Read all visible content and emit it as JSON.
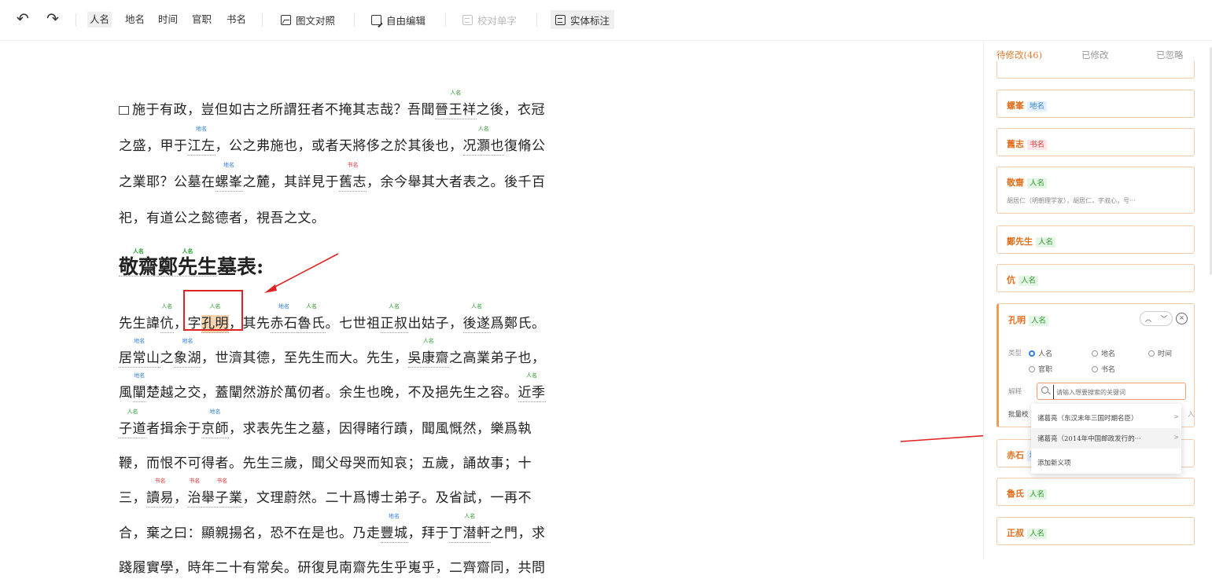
{
  "toolbar": {
    "undo_icon": "undo-icon",
    "redo_icon": "redo-icon",
    "filters": [
      "人名",
      "地名",
      "时间",
      "官职",
      "书名"
    ],
    "image_text_label": "图文对照",
    "free_edit_label": "自由编辑",
    "proof_label": "校对单字",
    "entity_label": "实体标注"
  },
  "tags": {
    "person": "人名",
    "place": "地名",
    "book": "书名"
  },
  "doc": {
    "lines": [
      [
        "施于有政，豈但如古之所謂狂者不掩其志哉？吾聞",
        {
          "t": "晉王祥",
          "k": "p"
        },
        "之後，衣冠"
      ],
      [
        "之盛，甲于",
        {
          "t": "江左",
          "k": "pl"
        },
        "，公之弗施也，或者天將侈之於其後也，",
        {
          "t": "况灝也",
          "k": "p"
        },
        "復脩公"
      ],
      [
        "之業耶？公墓在",
        {
          "t": "螺峯",
          "k": "pl"
        },
        "之麓，其詳見于",
        {
          "t": "舊志",
          "k": "bk"
        },
        "，余今舉其大者表之。後千百"
      ],
      [
        "祀，有道公之懿德者，視吾之文。"
      ],
      [
        "先生諱",
        {
          "t": "伉",
          "k": "p"
        },
        "，字",
        {
          "t": "孔明",
          "k": "p",
          "hl": true
        },
        "，其先",
        {
          "t": "赤石",
          "k": "pl"
        },
        {
          "t": "魯氏",
          "k": "p"
        },
        "。七世祖",
        {
          "t": "正叔",
          "k": "p"
        },
        "出姑子，",
        {
          "t": "後遂",
          "k": "p"
        },
        "爲鄭氏。"
      ],
      [
        {
          "t": "居常山",
          "k": "pl"
        },
        "之",
        {
          "t": "象湖",
          "k": "pl"
        },
        "，世濟其德，至先生而大。先生，",
        {
          "t": "吳康齋",
          "k": "p"
        },
        "之高業弟子也，"
      ],
      [
        "風",
        {
          "t": "闡",
          "k": "pl"
        },
        "楚越之交，蓋闡然游於萬仞者。余生也晚，不及挹先生之容。",
        {
          "t": "近季",
          "k": "p"
        }
      ],
      [
        {
          "t": "子道",
          "k": "p"
        },
        "者揖余于",
        {
          "t": "京師",
          "k": "pl"
        },
        "，求表先生之墓，因得睹行蹟，聞風慨然，樂爲執"
      ],
      [
        "鞭，而恨不可得者。先生三歲，聞父母哭而知哀；五歲，誦故事；十"
      ],
      [
        "三，",
        {
          "t": "讀易",
          "k": "bk"
        },
        "，",
        {
          "t": "治",
          "k": "bk"
        },
        {
          "t": "舉子業",
          "k": "bk"
        },
        "，文理蔚然。二十爲博士弟子。及省試，一再不"
      ],
      [
        "合，棄之曰：顯親揚名，恐不在是也。乃走",
        {
          "t": "豐城",
          "k": "pl"
        },
        "，拜于",
        {
          "t": "丁潜軒",
          "k": "p"
        },
        "之門，求"
      ],
      [
        "踐履實學，時年二十有常矣。研復見南齋先生乎嵬乎，二齊齋同，共問"
      ]
    ],
    "heading": [
      {
        "t": "敬齋",
        "k": "p"
      },
      {
        "t": "鄭先生",
        "k": "p"
      },
      "墓表:"
    ]
  },
  "panel": {
    "tabs": [
      "待修改(46)",
      "已修改",
      "已忽略"
    ],
    "cards": [
      {
        "name": "螺峯",
        "k": "pl"
      },
      {
        "name": "舊志",
        "k": "bk"
      },
      {
        "name": "敬齋",
        "k": "p",
        "desc": "胡居仁（明朝理学家），胡居仁，字叔心，号···"
      },
      {
        "name": "鄭先生",
        "k": "p"
      },
      {
        "name": "伉",
        "k": "p"
      },
      {
        "name": "孔明",
        "k": "p",
        "active": true
      },
      {
        "name": "赤石",
        "k": "pl"
      },
      {
        "name": "魯氏",
        "k": "p"
      },
      {
        "name": "正叔",
        "k": "p"
      }
    ],
    "editor": {
      "type_label": "类型",
      "types": [
        "人名",
        "地名",
        "时间",
        "官职",
        "书名"
      ],
      "explain_label": "解释",
      "search_placeholder": "请输入想要搜索的关键词",
      "batch_label": "批量校",
      "batch_tail": "入"
    },
    "dropdown": [
      "诸葛亮（东汉末年三国时期名臣）",
      "诸葛亮（2014年中国邮政发行的···",
      "添加新义项"
    ]
  }
}
